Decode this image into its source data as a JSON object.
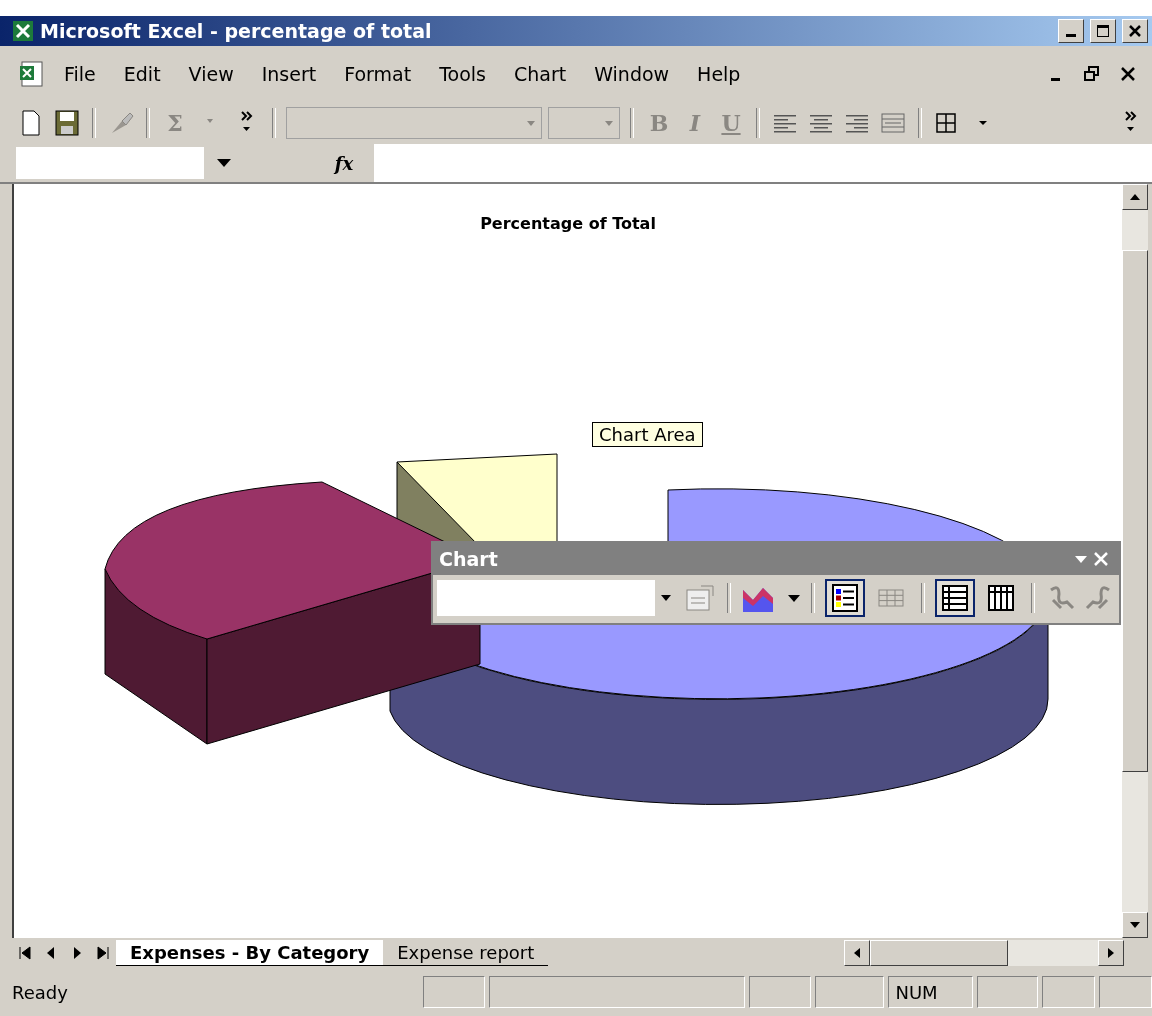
{
  "window": {
    "title": "Microsoft Excel - percentage of total"
  },
  "menu": [
    {
      "label": "File"
    },
    {
      "label": "Edit"
    },
    {
      "label": "View"
    },
    {
      "label": "Insert"
    },
    {
      "label": "Format"
    },
    {
      "label": "Tools"
    },
    {
      "label": "Chart"
    },
    {
      "label": "Window"
    },
    {
      "label": "Help"
    }
  ],
  "toolbar": {
    "glyphs": [
      {
        "kind": "sigma",
        "label": "Σ",
        "disabled": true
      },
      {
        "kind": "bold",
        "label": "B",
        "disabled": true
      },
      {
        "kind": "italic",
        "label": "I",
        "disabled": true
      },
      {
        "kind": "underline",
        "label": "U",
        "disabled": true
      }
    ]
  },
  "formula_bar": {
    "fx": "fx"
  },
  "chart": {
    "title": "Percentage of Total",
    "tooltip": "Chart Area"
  },
  "chart_toolbar": {
    "title": "Chart",
    "buttons": [
      {
        "kind": "legend",
        "selected": true
      },
      {
        "kind": "table",
        "selected": false
      },
      {
        "kind": "rows",
        "selected": true
      },
      {
        "kind": "columns",
        "selected": false
      }
    ]
  },
  "sheet_tabs": [
    {
      "label": "Expenses - By Category",
      "selected": true
    },
    {
      "label": "Expense report",
      "selected": false
    }
  ],
  "status_bar": {
    "message": "Ready",
    "indicators": [
      "NUM"
    ]
  }
}
